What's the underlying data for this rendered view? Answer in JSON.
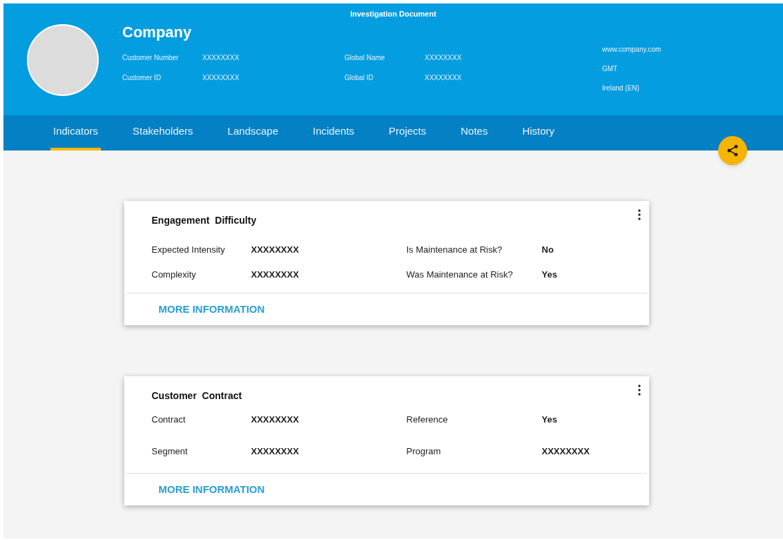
{
  "header": {
    "document_title": "Investigation Document",
    "company": "Company",
    "columns": [
      [
        {
          "label": "Customer Number",
          "value": "XXXXXXXX"
        },
        {
          "label": "Customer ID",
          "value": "XXXXXXXX"
        }
      ],
      [
        {
          "label": "Global Name",
          "value": "XXXXXXXX"
        },
        {
          "label": "Global ID",
          "value": "XXXXXXXX"
        }
      ]
    ],
    "info": [
      "www.company.com",
      "GMT",
      "Ireland (EN)"
    ]
  },
  "tabs": [
    {
      "label": "Indicators",
      "selected": true
    },
    {
      "label": "Stakeholders",
      "selected": false
    },
    {
      "label": "Landscape",
      "selected": false
    },
    {
      "label": "Incidents",
      "selected": false
    },
    {
      "label": "Projects",
      "selected": false
    },
    {
      "label": "Notes",
      "selected": false
    },
    {
      "label": "History",
      "selected": false
    }
  ],
  "cards": [
    {
      "title": "Engagement  Difficulty",
      "rows": [
        [
          {
            "label": "Expected Intensity",
            "value": "XXXXXXXX"
          },
          {
            "label": "Is Maintenance at Risk?",
            "value": "No"
          }
        ],
        [
          {
            "label": "Complexity",
            "value": "XXXXXXXX"
          },
          {
            "label": "Was Maintenance at Risk?",
            "value": "Yes"
          }
        ]
      ],
      "link": "MORE INFORMATION"
    },
    {
      "title": "Customer  Contract",
      "rows": [
        [
          {
            "label": "Contract",
            "value": "XXXXXXXX"
          },
          {
            "label": "Reference",
            "value": "Yes"
          }
        ],
        [
          {
            "label": "Segment",
            "value": "XXXXXXXX"
          },
          {
            "label": "Program",
            "value": "XXXXXXXX"
          }
        ]
      ],
      "link": "MORE INFORMATION"
    }
  ]
}
